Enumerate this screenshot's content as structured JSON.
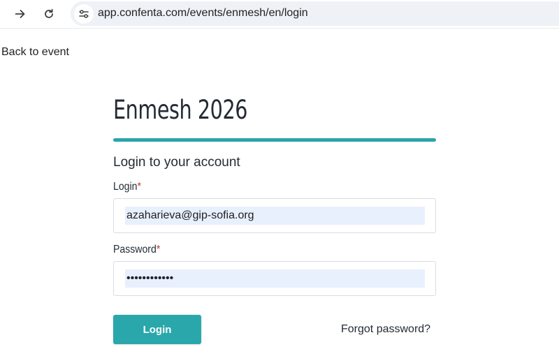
{
  "browser": {
    "url": "app.confenta.com/events/enmesh/en/login"
  },
  "page": {
    "back_link": "Back to event",
    "event_title": "Enmesh 2026",
    "form_heading": "Login to your account",
    "accent_color": "#2aa7ab"
  },
  "form": {
    "login_label": "Login",
    "login_value": "azaharieva@gip-sofia.org",
    "password_label": "Password",
    "password_value": "••••••••••••",
    "required_marker": "*",
    "submit_label": "Login",
    "forgot_label": "Forgot password?"
  },
  "icons": {
    "forward": "arrow-right-icon",
    "reload": "reload-icon",
    "site_info": "site-settings-icon"
  }
}
